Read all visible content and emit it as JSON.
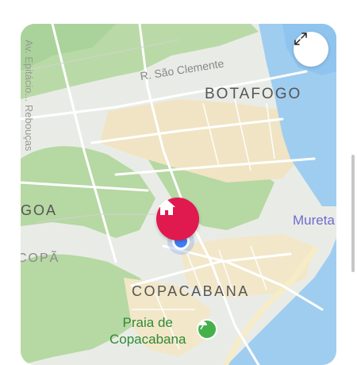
{
  "map": {
    "labels": {
      "botafogo": "BOTAFOGO",
      "copacabana": "COPACABANA",
      "goa": "GOA",
      "copa": "COPÃ",
      "street": "R. São Clemente",
      "road": "Av. Epitácio... Rebouças",
      "mureta": "Mureta",
      "praia_line1": "Praia de",
      "praia_line2": "Copacabana"
    },
    "colors": {
      "pin": "#e0194f",
      "park": "#b6d8a3",
      "water": "#9fcdf0",
      "urban": "#f2e7c9",
      "location_dot": "#3f7ef5",
      "beach_icon": "#46b14a"
    },
    "icons": {
      "expand": "expand-icon",
      "pin": "home-icon",
      "beach": "beach-umbrella-icon"
    }
  }
}
